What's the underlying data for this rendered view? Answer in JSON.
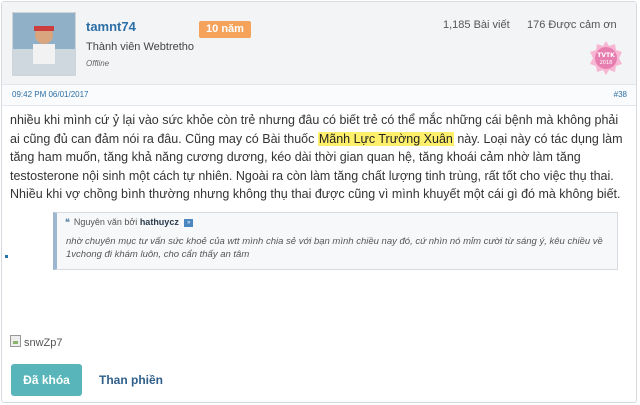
{
  "user": {
    "name": "tamnt74",
    "badge": "10 năm",
    "role": "Thành viên Webtretho",
    "status": "Offline",
    "posts": "1,185 Bài viết",
    "thanks": "176 Được cảm ơn",
    "medal_text_top": "TVTK",
    "medal_text_bottom": "2018"
  },
  "meta": {
    "date": "09:42 PM 06/01/2017",
    "post_number": "#38"
  },
  "body": {
    "line1": "nhiều khi mình cứ ỷ lại vào sức khỏe còn trẻ nhưng đâu có biết trẻ có thể mắc những cái bệnh mà không phải",
    "line2_before": "ai cũng đủ can đảm nói ra đâu. Cũng may có Bài thuốc ",
    "highlight": "Mãnh Lực Trường Xuân",
    "line2_after": " này. Loại này có tác dụng làm",
    "line3": "tăng ham muốn, tăng khả năng cương dương, kéo dài thời gian quan hệ, tăng khoái cảm nhờ làm tăng",
    "line4": "testosterone nội sinh một cách tự nhiên. Ngoài ra còn làm tăng chất lượng tinh trùng, rất tốt cho việc thụ thai.",
    "line5": "Nhiều khi vợ chồng bình thường nhưng không thụ thai được cũng vì mình khuyết một cái gì đó mà không biết."
  },
  "quote": {
    "prefix": "Nguyên văn bởi",
    "author": "hathuycz",
    "text": "nhờ chuyên mục tư vấn sức khoẻ của wtt mình chia sẻ với bạn mình chiều nay đó, cứ nhìn nó mỉm cười từ sáng ý, kêu chiều về 1vchong đi khám luôn, cho cẩn thấy an tâm"
  },
  "image_alt": "snwZp7",
  "buttons": {
    "lock": "Đã khóa",
    "report": "Than phiền"
  }
}
